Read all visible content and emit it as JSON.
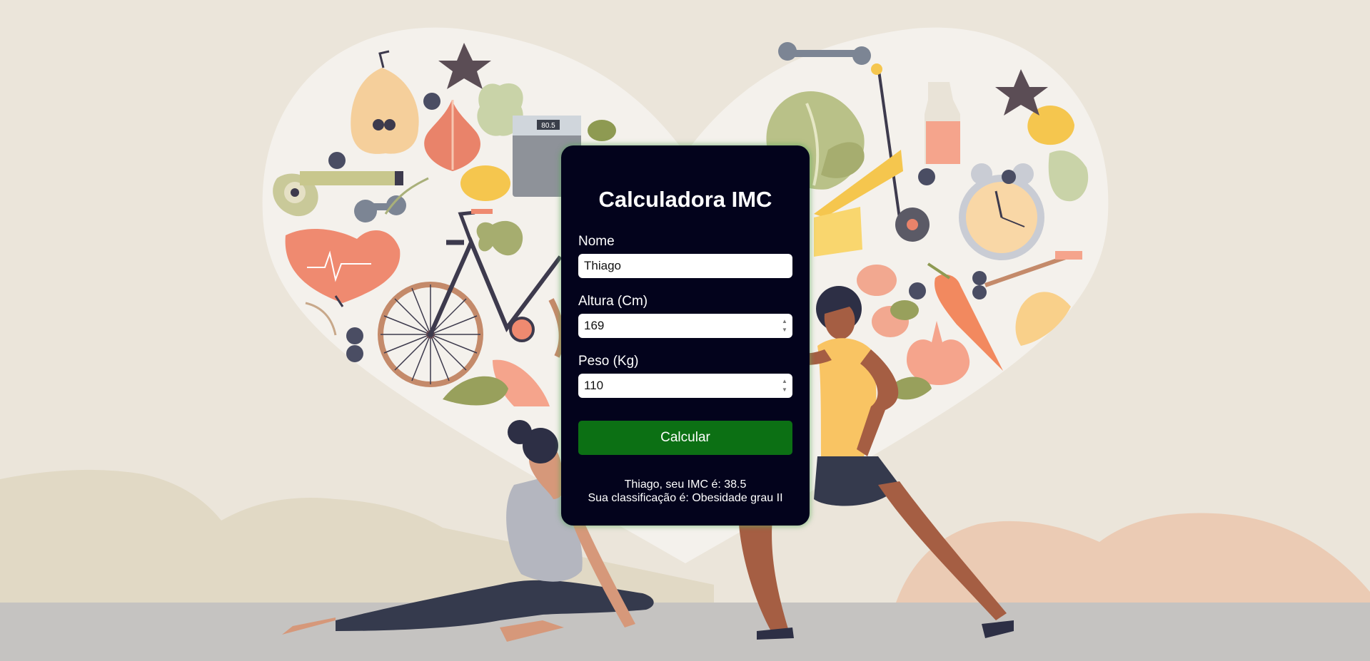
{
  "form": {
    "title": "Calculadora IMC",
    "name_label": "Nome",
    "name_value": "Thiago",
    "height_label": "Altura (Cm)",
    "height_value": "169",
    "weight_label": "Peso (Kg)",
    "weight_value": "110",
    "submit_label": "Calcular"
  },
  "result": {
    "line1": "Thiago, seu IMC é: 38.5",
    "line2": "Sua classificação é: Obesidade grau II"
  },
  "illustration": {
    "scale_display": "80.5"
  },
  "colors": {
    "background": "#ebe5da",
    "card": "#03031c",
    "button": "#0c7014",
    "floor": "#c5c3c1"
  }
}
